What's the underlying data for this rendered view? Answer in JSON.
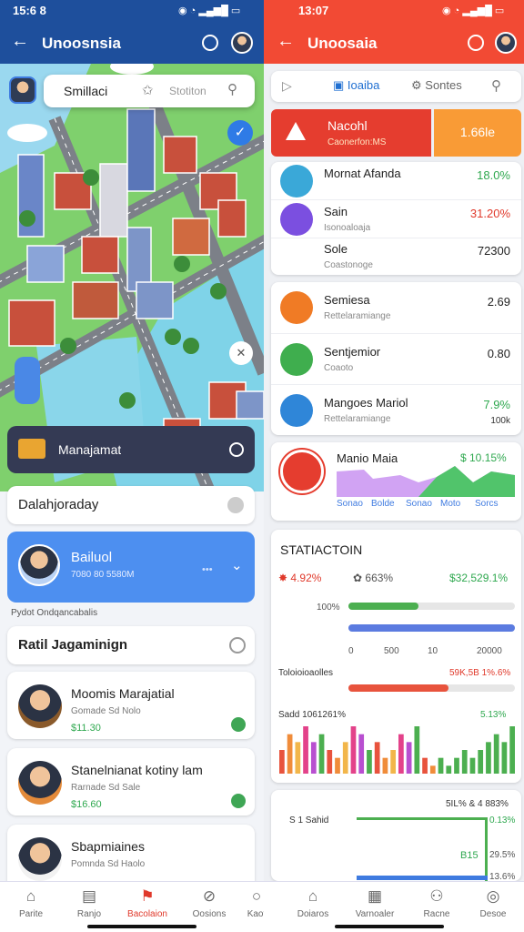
{
  "left": {
    "status": {
      "time": "15:6 8"
    },
    "header": {
      "title": "Unoosnsia"
    },
    "search": {
      "label": "Smillaci",
      "placeholder": "Stotiton"
    },
    "manage": {
      "label": "Manajamat"
    },
    "section1": {
      "title": "Dalahjoraday"
    },
    "profile": {
      "name": "Bailuol",
      "sub": "7080 80 5580M"
    },
    "caption": "Pydot Ondqancabalis",
    "list": {
      "title": "Ratil Jagaminign",
      "items": [
        {
          "name": "Moomis Marajatial",
          "sub": "Gomade Sd Nolo",
          "value": "$11.30"
        },
        {
          "name": "Stanelnianat kotiny lam",
          "sub": "Rarnade Sd Sale",
          "value": "$16.60"
        },
        {
          "name": "Sbapmiaines",
          "sub": "Pomnda Sd Haolo",
          "value": ""
        }
      ]
    },
    "nav": [
      {
        "label": "Parite",
        "icon": "home-icon"
      },
      {
        "label": "Ranjo",
        "icon": "list-icon"
      },
      {
        "label": "Bacolaion",
        "icon": "flag-icon"
      },
      {
        "label": "Oosions",
        "icon": "compass-icon"
      }
    ]
  },
  "right": {
    "status": {
      "time": "13:07"
    },
    "header": {
      "title": "Unoosaia"
    },
    "tabs": [
      {
        "label": "Ioaiba",
        "icon": "book-icon"
      },
      {
        "label": "Sontes",
        "icon": "gear-icon"
      }
    ],
    "alert": {
      "title": "Nacohl",
      "sub": "Caonerfon:MS",
      "value": "1.66le"
    },
    "group1": [
      {
        "name": "Mornat Afanda",
        "sub": "",
        "value": "18.0%",
        "color": "#2fa84f"
      },
      {
        "name": "Sain",
        "sub": "Isonoaloaja",
        "value": "31.20%",
        "color": "#e0392b"
      },
      {
        "name": "Sole",
        "sub": "Coastonoge",
        "value": "72300",
        "color": "#222222"
      }
    ],
    "group2": [
      {
        "name": "Semiesa",
        "sub": "Rettelaramiange",
        "value": "2.69",
        "color": "#222222"
      },
      {
        "name": "Sentjemior",
        "sub": "Coaoto",
        "value": "0.80",
        "color": "#222222"
      },
      {
        "name": "Mangoes Mariol",
        "sub": "Rettelaramiange",
        "value": "7.9%",
        "color": "#2fa84f",
        "extra": "100k"
      }
    ],
    "miniChart": {
      "title": "Manio Maia",
      "value": "$ 10.15%",
      "labels": [
        "Sonao",
        "Bolde",
        "Sonao",
        "Moto",
        "Sorcs"
      ]
    },
    "stats": {
      "title": "STATIACTOIN",
      "kpi1": "4.92%",
      "kpi2": "663%",
      "kpi3": "$32,529.1%",
      "bars": [
        {
          "label": "100%",
          "fill": 0.42,
          "color": "#4caf50"
        },
        {
          "label": "",
          "fill": 1.0,
          "color": "#5b7be0"
        }
      ],
      "ticks": [
        "0",
        "500",
        "10",
        "20000"
      ],
      "row2Label": "Toloioioaolles",
      "row2Value": "59K,5B 1%.6%",
      "row2Fill": 0.6,
      "histLabel": "Sadd 1061261%",
      "histValue": "5.13%",
      "histValues": [
        3,
        5,
        4,
        6,
        4,
        5,
        3,
        2,
        4,
        6,
        5,
        3,
        4,
        2,
        3,
        5,
        4,
        6,
        2,
        1,
        2,
        1,
        2,
        3,
        2,
        3,
        4,
        5,
        4,
        6
      ]
    },
    "bottomCard": {
      "label": "S 1 Sahid",
      "top": "5IL% & 4 883%",
      "mid1": "0.13%",
      "mid2": "B15",
      "mid3": "29.5%",
      "low": "13.6%"
    },
    "nav": [
      {
        "label": "Doiaros",
        "icon": "home-icon"
      },
      {
        "label": "Varnoaler",
        "icon": "calendar-icon"
      },
      {
        "label": "Racne",
        "icon": "people-icon"
      },
      {
        "label": "Desoe",
        "icon": "coin-icon"
      }
    ],
    "navMid": {
      "label": "Kaot"
    }
  }
}
